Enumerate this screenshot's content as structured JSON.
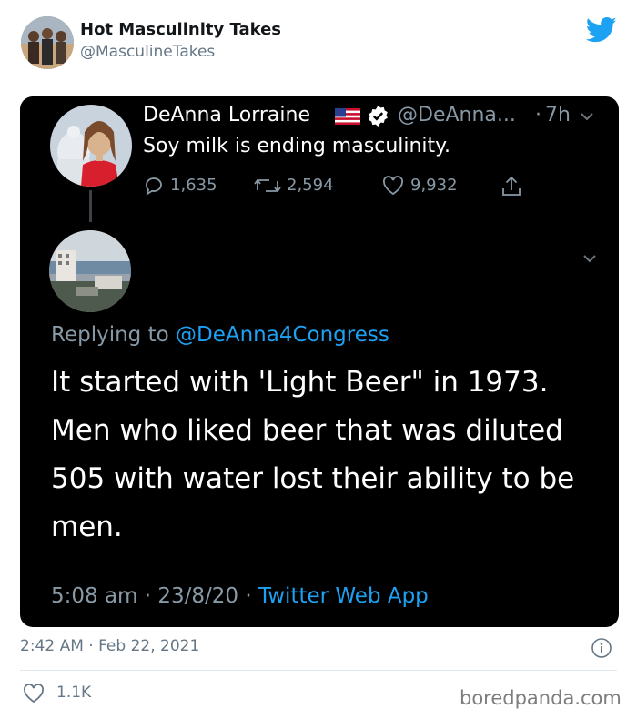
{
  "embed": {
    "author_name": "Hot Masculinity Takes",
    "author_handle": "@MasculineTakes",
    "timestamp": "2:42 AM · Feb 22, 2021",
    "likes": "1.1K"
  },
  "screenshot": {
    "tweet": {
      "name": "DeAnna Lorraine",
      "handle": "@DeAnna...",
      "dot": "·",
      "time": "7h",
      "text": "Soy milk is ending masculinity.",
      "replies": "1,635",
      "retweets": "2,594",
      "likes": "9,932"
    },
    "reply": {
      "replying_prefix": "Replying to",
      "replying_mention": "@DeAnna4Congress",
      "lines": [
        "It started with 'Light Beer\" in 1973.",
        "Men who liked beer that was diluted",
        "505 with water lost their ability to be",
        "men."
      ],
      "meta_time": "5:08 am · 23/8/20 ·",
      "meta_app": "Twitter Web App"
    }
  },
  "watermark": "boredpanda.com",
  "colors": {
    "twitter_blue": "#1da1f2",
    "dark_bg": "#000000",
    "muted_text": "#8899a6",
    "light_muted": "#657786"
  },
  "icons": [
    "twitter-logo-icon",
    "us-flag-icon",
    "verified-badge-icon",
    "chevron-down-icon",
    "reply-icon",
    "retweet-icon",
    "heart-icon",
    "share-icon",
    "info-icon"
  ]
}
